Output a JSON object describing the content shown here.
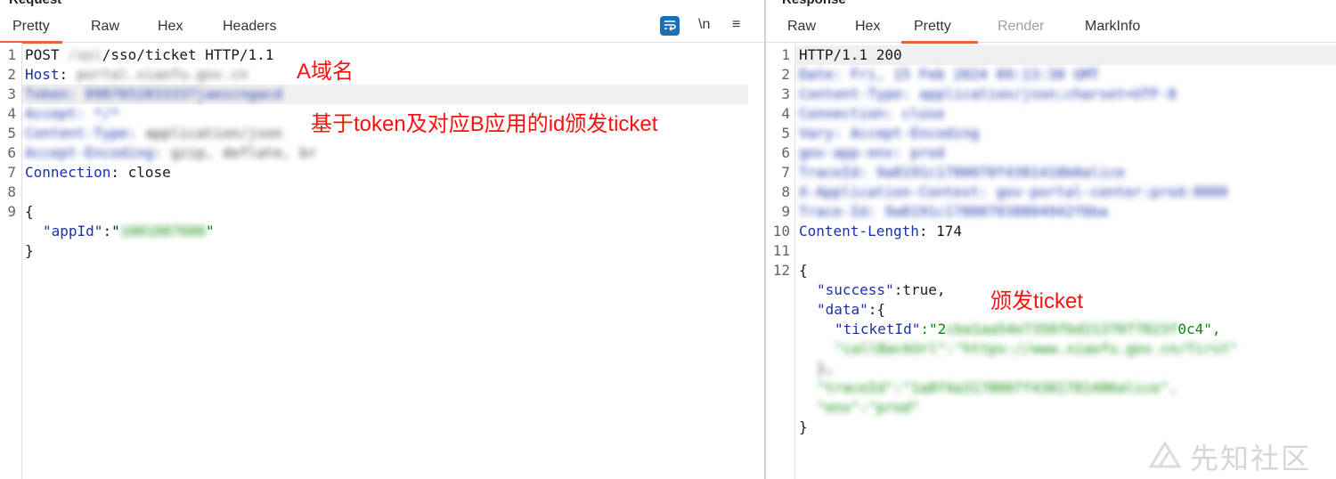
{
  "request": {
    "title": "Request",
    "tabs": [
      {
        "label": "Pretty",
        "active": true
      },
      {
        "label": "Raw"
      },
      {
        "label": "Hex"
      },
      {
        "label": "Headers"
      }
    ],
    "tools": {
      "newline_label": "\\n",
      "menu_label": "≡"
    },
    "line_numbers": [
      "1",
      "2",
      "3",
      "4",
      "5",
      "6",
      "7",
      "8",
      "9"
    ],
    "lines": {
      "l1_method": "POST ",
      "l1_blur": "/api",
      "l1_rest": "/sso/ticket HTTP/1.1",
      "host_key": "Host",
      "host_val": "portal.xiaofu.gov.cn",
      "h3": "Token: 8987652833337jaescngacd",
      "h4": "Accept: */*",
      "h5_key": "Content-Type: ",
      "h5_val": "application/json",
      "h6_key": "Accept-Encoding: ",
      "h6_val": "gzip, deflate, br",
      "conn_key": "Connection",
      "conn_val": ": close",
      "brace_open": "{",
      "appid_key": "\"appId\"",
      "colon_quote": ":\"",
      "appid_val": "1001087680",
      "quote": "\"",
      "brace_close": "}"
    }
  },
  "response": {
    "title": "Response",
    "tabs": [
      {
        "label": "Raw"
      },
      {
        "label": "Hex"
      },
      {
        "label": "Pretty",
        "active": true
      },
      {
        "label": "Render",
        "disabled": true
      },
      {
        "label": "MarkInfo"
      }
    ],
    "line_numbers": [
      "1",
      "2",
      "3",
      "4",
      "5",
      "6",
      "7",
      "8",
      "9",
      "10",
      "11",
      "12"
    ],
    "lines": {
      "status": "HTTP/1.1 200",
      "r2": "Date: Fri, 15 Feb 2024 09:13:30 GMT",
      "r3": "Content-Type: application/json;charset=UTF-8",
      "r4": "Connection: close",
      "r5": "Vary: Accept-Encoding",
      "r6": "gov-app-env: prod",
      "r7": "TraceId: 9a8191c1780070f4381418b0alice",
      "r8": "X-Application-Context: gov-portal-center:prod:8080",
      "r9": "Trace-Id: 9a8191c178007038804942f6ba",
      "cl_key": "Content-Length",
      "cl_val": ": 174",
      "brace_open": "{",
      "success_key": "\"success\"",
      "success_val": ":true,",
      "data_key": "\"data\"",
      "data_open": ":{",
      "ticket_key": "\"ticketId\"",
      "ticket_pre": ":\"2",
      "ticket_blur": "cba1aa54e7356fbd2137077823f",
      "ticket_post": "0c4\",",
      "b1": "\"callBackUrl\":\"https://www.xiaofu.gov.cn/first\"",
      "b2": "},",
      "b3": "\"traceId\":\"1a8f4a3178007f4381781486alice\",",
      "b4": "\"env\":\"prod\"",
      "brace_close": "}"
    }
  },
  "annotations": {
    "a_domain": "A域名",
    "token_note": "基于token及对应B应用的id颁发ticket",
    "ticket_note": "颁发ticket"
  },
  "watermark": "先知社区",
  "colors": {
    "accent": "#e8643c",
    "annotation": "#ff1010",
    "wrap_button": "#1f6fb5"
  }
}
